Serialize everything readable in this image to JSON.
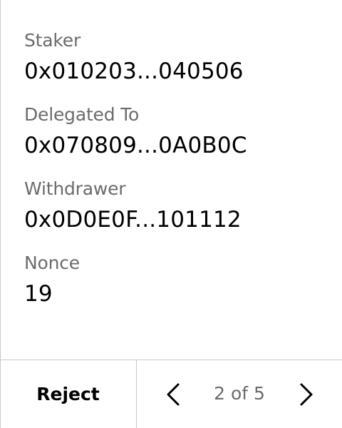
{
  "fields": [
    {
      "label": "Staker",
      "value": "0x010203...040506"
    },
    {
      "label": "Delegated To",
      "value": "0x070809...0A0B0C"
    },
    {
      "label": "Withdrawer",
      "value": "0x0D0E0F...101112"
    },
    {
      "label": "Nonce",
      "value": "19"
    }
  ],
  "footer": {
    "reject_label": "Reject",
    "page_indicator": "2 of 5",
    "prev_icon": "chevron-left-icon",
    "next_icon": "chevron-right-icon"
  },
  "colors": {
    "label": "#6b6b6b",
    "value": "#000000",
    "divider": "#c9c9c9",
    "background": "#ffffff"
  }
}
